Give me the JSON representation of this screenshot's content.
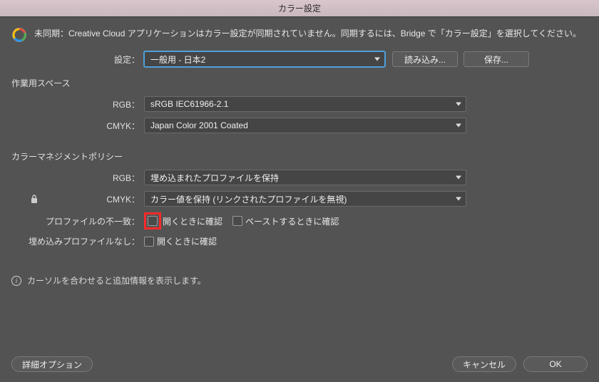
{
  "title": "カラー設定",
  "sync_message": "未同期：Creative Cloud アプリケーションはカラー設定が同期されていません。同期するには、Bridge で「カラー設定」を選択してください。",
  "settings": {
    "label": "設定：",
    "value": "一般用 - 日本2",
    "load": "読み込み...",
    "save": "保存..."
  },
  "workspace": {
    "heading": "作業用スペース",
    "rgb_label": "RGB：",
    "rgb_value": "sRGB IEC61966-2.1",
    "cmyk_label": "CMYK：",
    "cmyk_value": "Japan Color 2001 Coated"
  },
  "policy": {
    "heading": "カラーマネジメントポリシー",
    "rgb_label": "RGB：",
    "rgb_value": "埋め込まれたプロファイルを保持",
    "cmyk_label": "CMYK：",
    "cmyk_value": "カラー値を保持 (リンクされたプロファイルを無視)",
    "mismatch_label": "プロファイルの不一致：",
    "mismatch_open": "開くときに確認",
    "mismatch_paste": "ペーストするときに確認",
    "missing_label": "埋め込みプロファイルなし：",
    "missing_open": "開くときに確認"
  },
  "info_hint": "カーソルを合わせると追加情報を表示します。",
  "footer": {
    "advanced": "詳細オプション",
    "cancel": "キャンセル",
    "ok": "OK"
  }
}
